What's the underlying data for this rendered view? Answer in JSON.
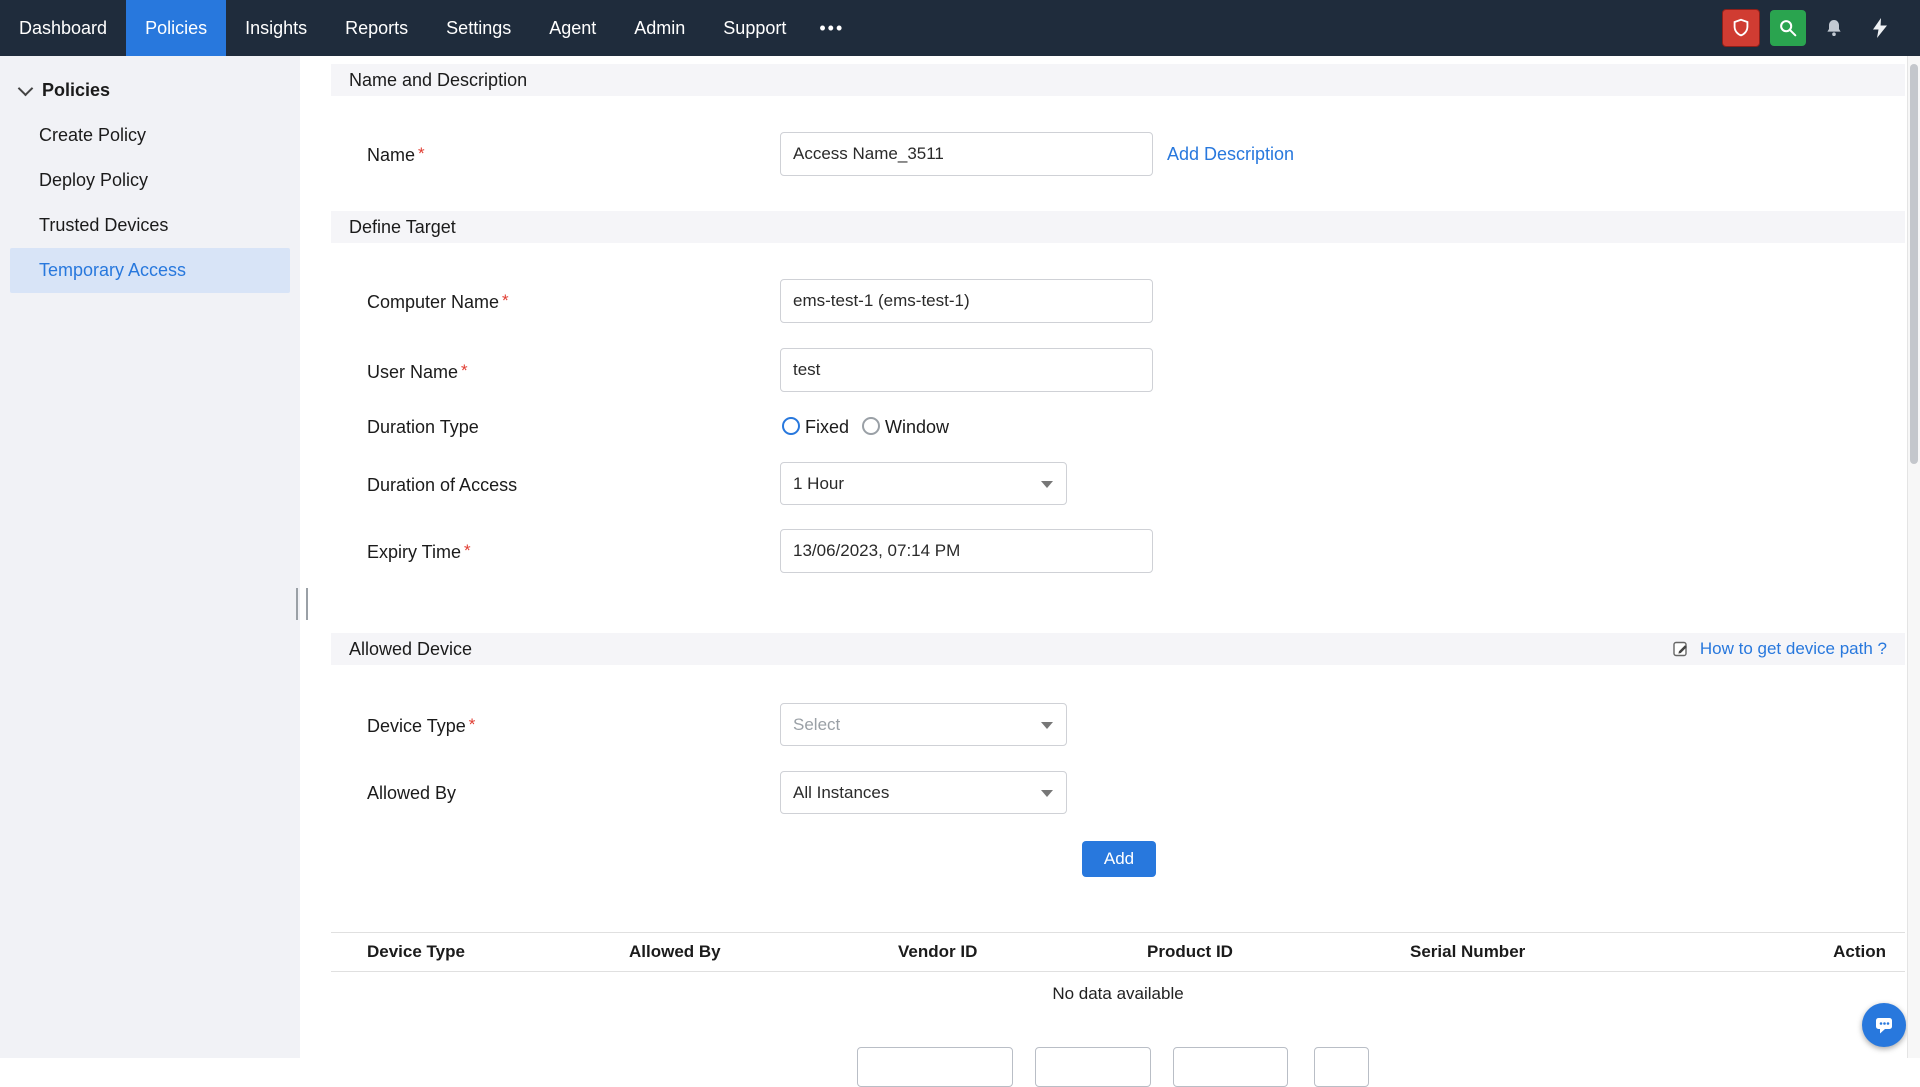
{
  "ui": {
    "required_marker": "*"
  },
  "colors": {
    "accent": "#2878dd",
    "nav_background": "#1f2c3c",
    "shield_red": "#d03c32",
    "search_green": "#2aa44f",
    "sidebar_selected_bg": "#d8e4f7",
    "required_red": "#e03c31"
  },
  "topnav": {
    "items": [
      {
        "label": "Dashboard",
        "active": false
      },
      {
        "label": "Policies",
        "active": true
      },
      {
        "label": "Insights",
        "active": false
      },
      {
        "label": "Reports",
        "active": false
      },
      {
        "label": "Settings",
        "active": false
      },
      {
        "label": "Agent",
        "active": false
      },
      {
        "label": "Admin",
        "active": false
      },
      {
        "label": "Support",
        "active": false
      }
    ],
    "more_label": "•••",
    "icons": [
      "shield-icon",
      "search-icon",
      "bell-icon",
      "flash-icon"
    ]
  },
  "sidebar": {
    "header": "Policies",
    "items": [
      {
        "label": "Create Policy",
        "selected": false
      },
      {
        "label": "Deploy Policy",
        "selected": false
      },
      {
        "label": "Trusted Devices",
        "selected": false
      },
      {
        "label": "Temporary Access",
        "selected": true
      }
    ]
  },
  "name_section": {
    "title": "Name and Description",
    "name_label": "Name",
    "name_value": "Access Name_3511",
    "add_description_link": "Add Description"
  },
  "target_section": {
    "title": "Define Target",
    "computer_name_label": "Computer Name",
    "computer_name_value": "ems-test-1 (ems-test-1)",
    "user_name_label": "User Name",
    "user_name_value": "test",
    "duration_type_label": "Duration Type",
    "duration_type_options": [
      {
        "label": "Fixed",
        "selected": true
      },
      {
        "label": "Window",
        "selected": false
      }
    ],
    "duration_access_label": "Duration of Access",
    "duration_access_value": "1 Hour",
    "expiry_label": "Expiry Time",
    "expiry_value": "13/06/2023, 07:14 PM"
  },
  "device_section": {
    "title": "Allowed Device",
    "help_link": "How to get device path ?",
    "device_type_label": "Device Type",
    "device_type_placeholder": "Select",
    "allowed_by_label": "Allowed By",
    "allowed_by_value": "All Instances",
    "add_button_label": "Add"
  },
  "device_table": {
    "columns": [
      "Device Type",
      "Allowed By",
      "Vendor ID",
      "Product ID",
      "Serial Number",
      "Action"
    ],
    "empty_message": "No data available"
  }
}
